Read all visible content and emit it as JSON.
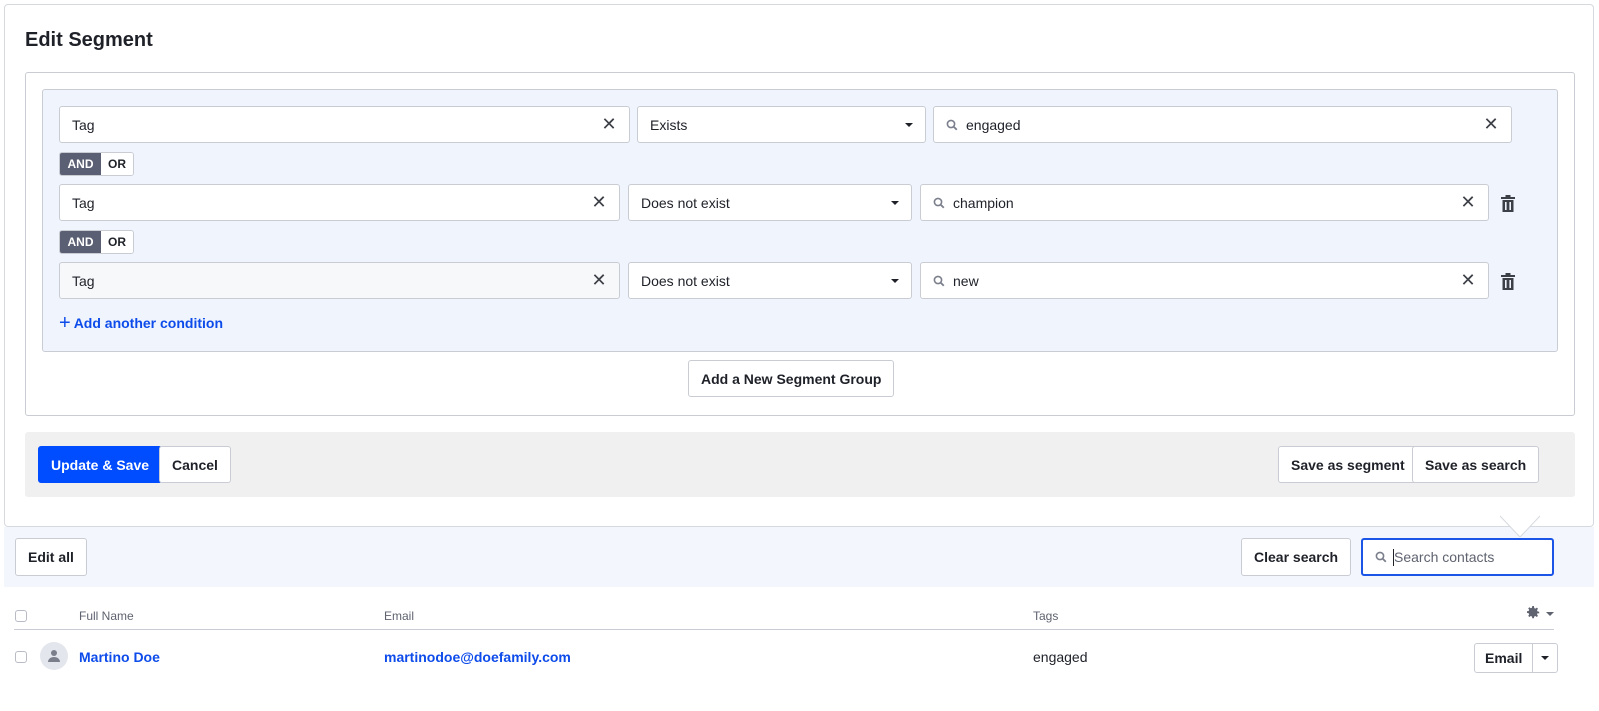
{
  "page": {
    "title": "Edit Segment"
  },
  "segment_group": {
    "conditions": [
      {
        "field": "Tag",
        "operator": "Exists",
        "value": "engaged",
        "deletable": false
      },
      {
        "field": "Tag",
        "operator": "Does not exist",
        "value": "champion",
        "deletable": true
      },
      {
        "field": "Tag",
        "operator": "Does not exist",
        "value": "new",
        "deletable": true
      }
    ],
    "logic_toggles": [
      {
        "and_label": "AND",
        "or_label": "OR",
        "selected": "AND"
      },
      {
        "and_label": "AND",
        "or_label": "OR",
        "selected": "AND"
      }
    ],
    "add_condition_label": "Add another condition"
  },
  "add_group_label": "Add a New Segment Group",
  "footer": {
    "update_save_label": "Update & Save",
    "cancel_label": "Cancel",
    "save_segment_label": "Save as segment",
    "save_search_label": "Save as search"
  },
  "toolbar": {
    "edit_all_label": "Edit all",
    "clear_search_label": "Clear search",
    "search_placeholder": "Search contacts",
    "search_value": ""
  },
  "table": {
    "columns": [
      "Full Name",
      "Email",
      "Tags"
    ],
    "rows": [
      {
        "full_name": "Martino Doe",
        "email": "martinodoe@doefamily.com",
        "tags": "engaged",
        "action_label": "Email"
      }
    ]
  },
  "colors": {
    "primary": "#004cff",
    "link": "#0d4bea",
    "logic_active": "#5b5f73",
    "group_bg": "#eff4fd"
  }
}
